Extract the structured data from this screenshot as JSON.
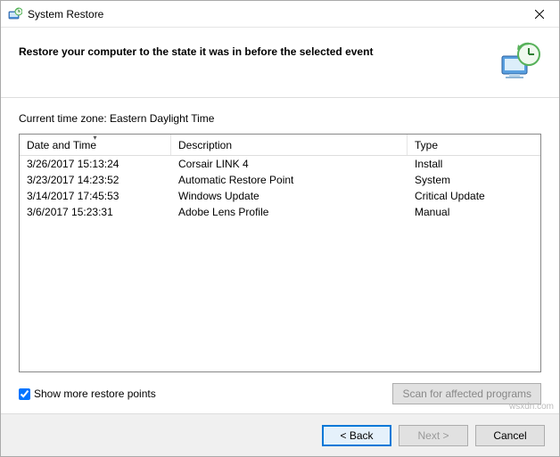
{
  "window": {
    "title": "System Restore"
  },
  "header": {
    "text": "Restore your computer to the state it was in before the selected event"
  },
  "timezone_label": "Current time zone: Eastern Daylight Time",
  "columns": {
    "date": "Date and Time",
    "desc": "Description",
    "type": "Type"
  },
  "rows": [
    {
      "date": "3/26/2017 15:13:24",
      "desc": "Corsair LINK 4",
      "type": "Install"
    },
    {
      "date": "3/23/2017 14:23:52",
      "desc": "Automatic Restore Point",
      "type": "System"
    },
    {
      "date": "3/14/2017 17:45:53",
      "desc": "Windows Update",
      "type": "Critical Update"
    },
    {
      "date": "3/6/2017 15:23:31",
      "desc": "Adobe Lens Profile",
      "type": "Manual"
    }
  ],
  "show_more": {
    "label": "Show more restore points",
    "checked": true
  },
  "scan_button": "Scan for affected programs",
  "buttons": {
    "back": "< Back",
    "next": "Next >",
    "cancel": "Cancel"
  },
  "watermark": "wsxdn.com"
}
